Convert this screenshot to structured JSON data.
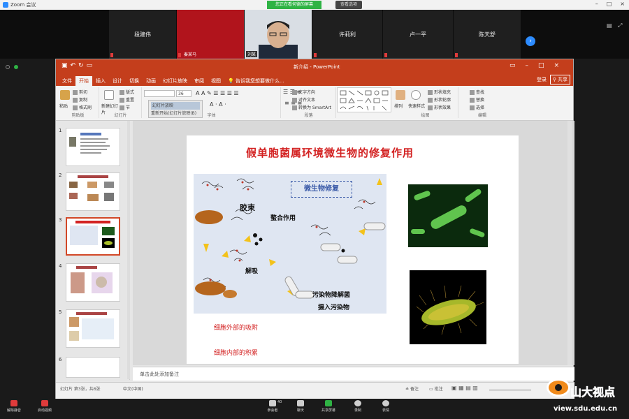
{
  "zoom": {
    "title": "Zoom 会议",
    "share_banner": "您正在看何德的屏幕",
    "view_options": "查看选项",
    "participants": [
      {
        "name": "段建伟"
      },
      {
        "name": "秦某马"
      },
      {
        "name": "刘某"
      },
      {
        "name": "许莉利"
      },
      {
        "name": "卢一平"
      },
      {
        "name": "陈天舒"
      }
    ],
    "toolbar": {
      "mute": "解除静音",
      "video": "启动视频",
      "participants": "参会者",
      "participants_count": "40",
      "chat": "聊天",
      "share": "共享屏幕",
      "record": "录制",
      "reactions": "表情"
    }
  },
  "ppt": {
    "window_title": "新介绍 - PowerPoint",
    "tabs": [
      "文件",
      "开始",
      "插入",
      "设计",
      "切换",
      "动画",
      "幻灯片放映",
      "审阅",
      "视图"
    ],
    "active_tab": "开始",
    "tell_me": "告诉我您想要做什么...",
    "login": "登录",
    "share": "共享",
    "ribbon": {
      "clipboard": {
        "label": "剪贴板",
        "paste": "粘贴",
        "cut": "剪切",
        "copy": "复制",
        "format_painter": "格式刷"
      },
      "slides": {
        "label": "幻灯片",
        "new_slide": "新建幻灯片",
        "layout": "版式",
        "reset": "重置",
        "section": "节"
      },
      "font": {
        "label": "字体",
        "size": "36"
      },
      "tooltip": {
        "line1": "幻灯片放映",
        "line2": "重新开始(幻灯片放映(B)"
      },
      "paragraph": {
        "label": "段落",
        "text_direction": "文字方向",
        "align_text": "对齐文本",
        "smartart": "转换为 SmartArt"
      },
      "drawing": {
        "label": "绘图",
        "arrange": "排列",
        "quick_styles": "快速样式",
        "fill": "形状填充",
        "outline": "形状轮廓",
        "effects": "形状效果"
      },
      "editing": {
        "label": "编辑",
        "find": "查找",
        "replace": "替换",
        "select": "选择"
      }
    },
    "thumbnails": [
      {
        "num": "1",
        "selected": false
      },
      {
        "num": "2",
        "selected": false
      },
      {
        "num": "3",
        "selected": true
      },
      {
        "num": "4",
        "selected": false
      },
      {
        "num": "5",
        "selected": false
      },
      {
        "num": "6",
        "selected": false
      }
    ],
    "slide": {
      "title": "假单胞菌属环境微生物的修复作用",
      "diagram_box": "微生物修复",
      "labels": {
        "micelle": "胶束",
        "chelation": "螯合作用",
        "desorption": "解吸",
        "degrader": "污染物降解菌",
        "uptake": "摄入污染物"
      },
      "note1": "细胞外部的吸附",
      "note2": "细胞内部的积累"
    },
    "notes_placeholder": "单击此处添加备注",
    "status": {
      "slide_info": "幻灯片 第3张，共6张",
      "language": "中文(中国)",
      "notes": "备注",
      "comments": "批注"
    }
  },
  "watermark": {
    "brand": "山大视点",
    "url": "view.sdu.edu.cn"
  },
  "colors": {
    "ppt_accent": "#c43e1c",
    "zoom_green": "#2fb344",
    "zoom_blue": "#2d8cff",
    "slide_title": "#d32222"
  }
}
